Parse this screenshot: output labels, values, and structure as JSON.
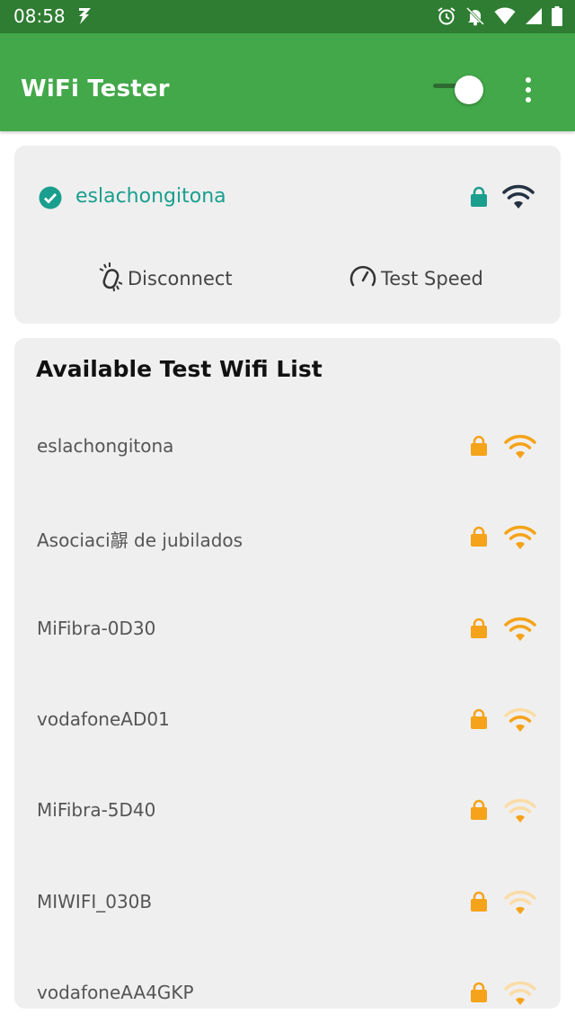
{
  "status_bar": {
    "time": "08:58",
    "icons": [
      "flash-icon",
      "alarm-icon",
      "notifications-off-icon",
      "wifi-icon",
      "signal-icon",
      "battery-icon"
    ]
  },
  "app_bar": {
    "title": "WiFi Tester",
    "toggle_on": true,
    "menu_icon": "more-vert-icon"
  },
  "current_network": {
    "ssid": "eslachongitona",
    "connected_icon": "check-circle-icon",
    "secured": true,
    "signal_level": 4,
    "actions": {
      "disconnect_label": "Disconnect",
      "test_speed_label": "Test Speed"
    }
  },
  "wifi_list": {
    "title": "Available Test Wifi List",
    "networks": [
      {
        "ssid": "eslachongitona",
        "secured": true,
        "signal_level": 4
      },
      {
        "ssid": "Asociaci髜 de jubilados",
        "secured": true,
        "signal_level": 4
      },
      {
        "ssid": "MiFibra-0D30",
        "secured": true,
        "signal_level": 4
      },
      {
        "ssid": "vodafoneAD01",
        "secured": true,
        "signal_level": 2
      },
      {
        "ssid": "MiFibra-5D40",
        "secured": true,
        "signal_level": 1
      },
      {
        "ssid": "MIWIFI_030B",
        "secured": true,
        "signal_level": 1
      },
      {
        "ssid": "vodafoneAA4GKP",
        "secured": true,
        "signal_level": 1
      }
    ]
  },
  "colors": {
    "status_bar": "#2e7d32",
    "app_bar": "#43a84a",
    "accent_teal": "#1a9e8e",
    "wifi_orange": "#f5a31a",
    "wifi_orange_faded": "#fbdca6",
    "card_bg": "#efefef"
  }
}
